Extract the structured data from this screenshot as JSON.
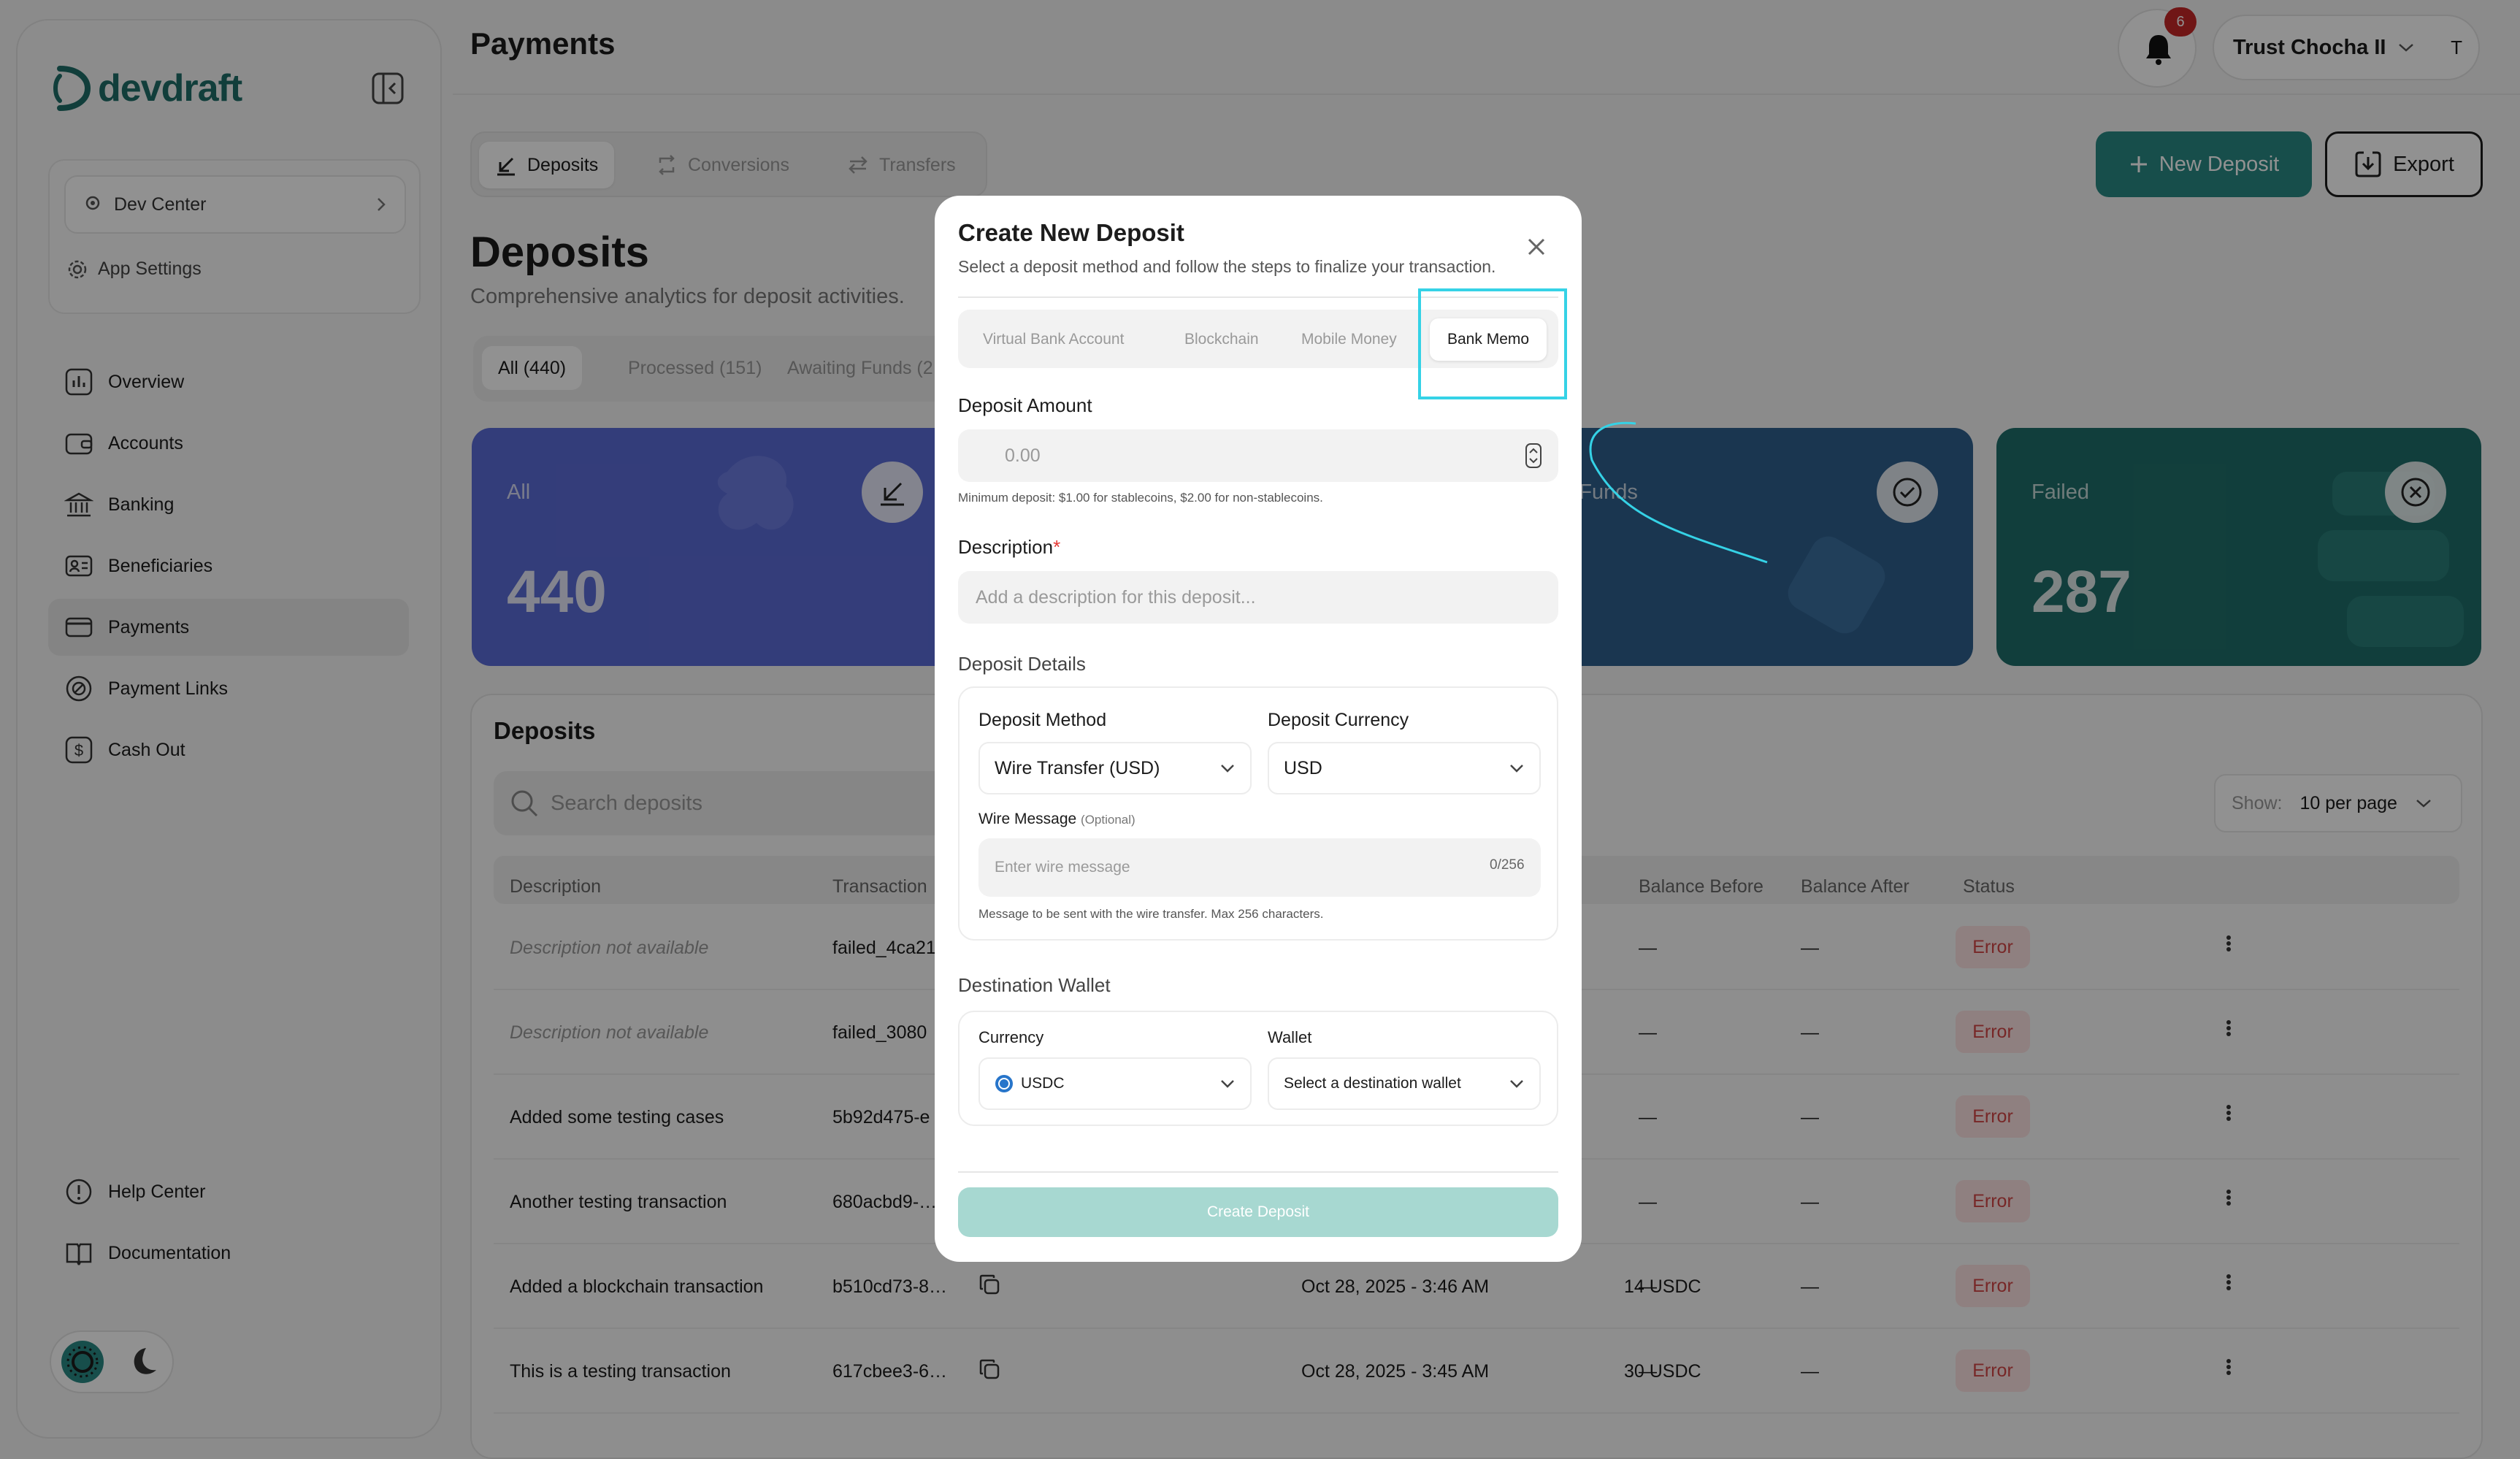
{
  "brand": {
    "name": "devdraft"
  },
  "sidebar": {
    "dev_center": "Dev Center",
    "app_settings": "App Settings",
    "items": [
      {
        "label": "Overview",
        "icon": "chart-icon"
      },
      {
        "label": "Accounts",
        "icon": "wallet-icon"
      },
      {
        "label": "Banking",
        "icon": "bank-icon"
      },
      {
        "label": "Beneficiaries",
        "icon": "contact-card-icon"
      },
      {
        "label": "Payments",
        "icon": "card-icon",
        "active": true
      },
      {
        "label": "Payment Links",
        "icon": "link-icon"
      },
      {
        "label": "Cash Out",
        "icon": "dollar-icon"
      }
    ],
    "footer_items": [
      {
        "label": "Help Center",
        "icon": "help-icon"
      },
      {
        "label": "Documentation",
        "icon": "book-icon"
      }
    ]
  },
  "header": {
    "title": "Payments",
    "notifications_count": "6",
    "user_name": "Trust Chocha II",
    "user_initial": "T"
  },
  "section_tabs": [
    "Deposits",
    "Conversions",
    "Transfers"
  ],
  "actions": {
    "new_deposit": "New Deposit",
    "export": "Export"
  },
  "deposits": {
    "title": "Deposits",
    "subtitle": "Comprehensive analytics for deposit activities.",
    "filters": [
      "All (440)",
      "Processed (151)",
      "Awaiting Funds (2"
    ],
    "stats": [
      {
        "label": "All",
        "value": "440",
        "color": "#5b6bd6"
      },
      {
        "label": "Awaiting Funds",
        "value": "",
        "color": "#2f5f8e"
      },
      {
        "label": "Failed",
        "value": "287",
        "color": "#1f6e6a"
      }
    ],
    "stat_partial_label": "ng Funds"
  },
  "table": {
    "title": "Deposits",
    "search_placeholder": "Search deposits",
    "show_label": "Show:",
    "per_page": "10 per page",
    "columns": [
      "Description",
      "Transaction",
      "Balance Before",
      "Balance After",
      "Status"
    ],
    "rows": [
      {
        "description": "Description not available",
        "muted": true,
        "tx": "failed_4ca21",
        "date": "",
        "amount": "",
        "before": "—",
        "after": "—",
        "status": "Error"
      },
      {
        "description": "Description not available",
        "muted": true,
        "tx": "failed_3080",
        "date": "",
        "amount": "",
        "before": "—",
        "after": "—",
        "status": "Error"
      },
      {
        "description": "Added some testing cases",
        "muted": false,
        "tx": "5b92d475-e",
        "date": "",
        "amount": "",
        "before": "—",
        "after": "—",
        "status": "Error"
      },
      {
        "description": "Another testing transaction",
        "muted": false,
        "tx": "680acbd9-…",
        "date": "",
        "amount": "",
        "before": "—",
        "after": "—",
        "status": "Error"
      },
      {
        "description": "Added a blockchain transaction",
        "muted": false,
        "tx": "b510cd73-8…",
        "date": "Oct 28, 2025 - 3:46 AM",
        "amount": "14 USDC",
        "before": "—",
        "after": "—",
        "status": "Error"
      },
      {
        "description": "This is a testing transaction",
        "muted": false,
        "tx": "617cbee3-6…",
        "date": "Oct 28, 2025 - 3:45 AM",
        "amount": "30 USDC",
        "before": "—",
        "after": "—",
        "status": "Error"
      }
    ]
  },
  "modal": {
    "title": "Create New Deposit",
    "subtitle": "Select a deposit method and follow the steps to finalize your transaction.",
    "methods": [
      "Virtual Bank Account",
      "Blockchain",
      "Mobile Money",
      "Bank Memo"
    ],
    "active_method": "Bank Memo",
    "amount_label": "Deposit Amount",
    "amount_placeholder": "0.00",
    "amount_hint": "Minimum deposit: $1.00 for stablecoins, $2.00 for non-stablecoins.",
    "description_label": "Description",
    "description_required_mark": "*",
    "description_placeholder": "Add a description for this deposit...",
    "details_title": "Deposit Details",
    "method_label": "Deposit Method",
    "method_value": "Wire Transfer (USD)",
    "currency_label": "Deposit Currency",
    "currency_value": "USD",
    "wire_label": "Wire Message",
    "wire_optional": "(Optional)",
    "wire_placeholder": "Enter wire message",
    "wire_counter": "0/256",
    "wire_hint": "Message to be sent with the wire transfer. Max 256 characters.",
    "dest_title": "Destination Wallet",
    "dest_currency_label": "Currency",
    "dest_currency_value": "USDC",
    "dest_wallet_label": "Wallet",
    "dest_wallet_value": "Select a destination wallet",
    "submit": "Create Deposit"
  },
  "colors": {
    "accent": "#2a8a84",
    "highlight": "#35d2e6",
    "error": "#d14646"
  }
}
